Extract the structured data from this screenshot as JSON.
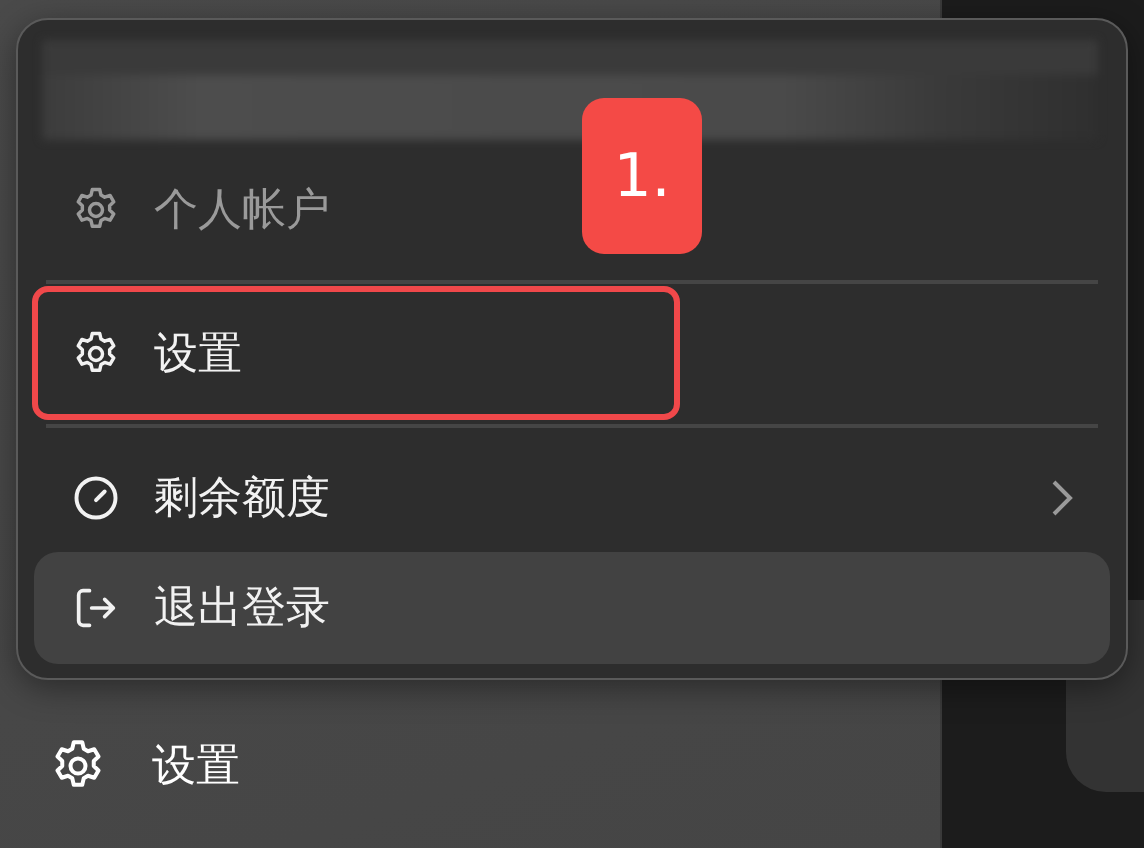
{
  "menu": {
    "items": [
      {
        "label": "个人帐户",
        "kind": "gear",
        "disabled": true,
        "hovered": false,
        "boxed": false,
        "submenu": false,
        "divider_after": true
      },
      {
        "label": "设置",
        "kind": "gear",
        "disabled": false,
        "hovered": false,
        "boxed": true,
        "submenu": false,
        "divider_after": true
      },
      {
        "label": "剩余额度",
        "kind": "gauge",
        "disabled": false,
        "hovered": false,
        "boxed": false,
        "submenu": true,
        "divider_after": false
      },
      {
        "label": "退出登录",
        "kind": "logout",
        "disabled": false,
        "hovered": true,
        "boxed": false,
        "submenu": false,
        "divider_after": false
      }
    ]
  },
  "step_badge": "1.",
  "sidebar": {
    "items": [
      {
        "label": "设置",
        "kind": "gear"
      }
    ]
  }
}
